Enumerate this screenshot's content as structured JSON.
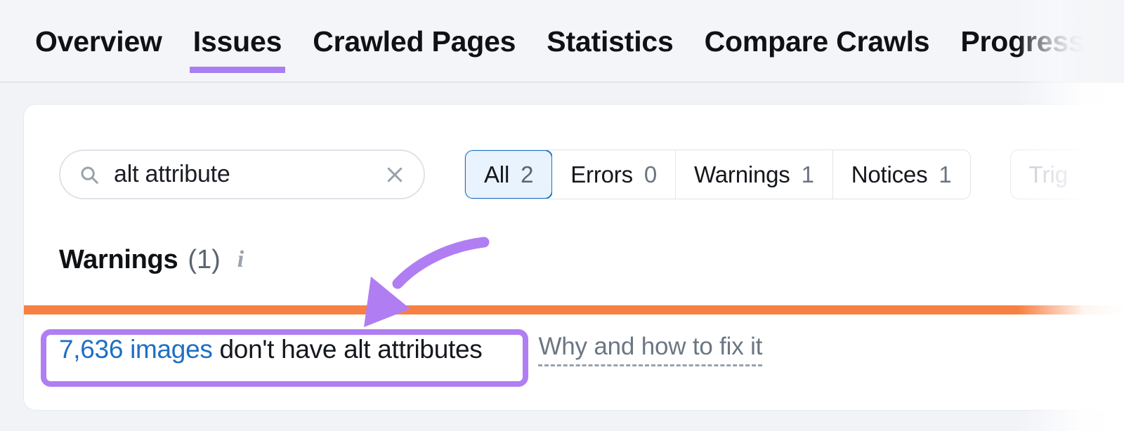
{
  "tabs": [
    {
      "label": "Overview",
      "active": false
    },
    {
      "label": "Issues",
      "active": true
    },
    {
      "label": "Crawled Pages",
      "active": false
    },
    {
      "label": "Statistics",
      "active": false
    },
    {
      "label": "Compare Crawls",
      "active": false
    },
    {
      "label": "Progress",
      "active": false
    }
  ],
  "search": {
    "value": "alt attribute",
    "placeholder": "Search",
    "icon": "search-icon",
    "clear_icon": "close-icon"
  },
  "filters": [
    {
      "label": "All",
      "count": "2",
      "selected": true
    },
    {
      "label": "Errors",
      "count": "0",
      "selected": false
    },
    {
      "label": "Warnings",
      "count": "1",
      "selected": false
    },
    {
      "label": "Notices",
      "count": "1",
      "selected": false
    }
  ],
  "extra_filter": {
    "label": "Trig"
  },
  "section": {
    "title": "Warnings",
    "count": "(1)",
    "info_icon": "info-icon"
  },
  "issue": {
    "link_text": "7,636 images",
    "rest_text": " don't have alt attributes",
    "fix_link": "Why and how to fix it"
  },
  "colors": {
    "accent_purple": "#a87ef5",
    "annotation_purple": "#b07ef2",
    "bar_orange": "#f78143",
    "link_blue": "#1f6ec4",
    "selected_pill_border": "#1a73c8",
    "selected_pill_bg": "#e8f3fd",
    "page_bg": "#f1f3f7",
    "card_bg": "#ffffff"
  }
}
